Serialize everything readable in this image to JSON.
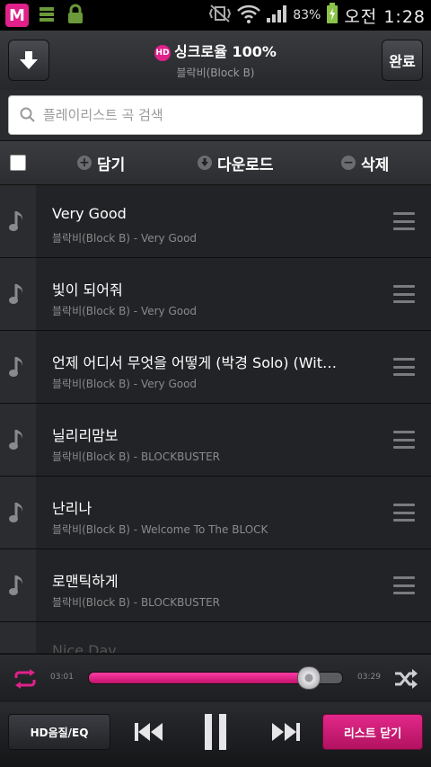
{
  "status_bar": {
    "battery": "83%",
    "clock": "오전 1:28",
    "app_icon_letter": "M"
  },
  "header": {
    "badge": "HD",
    "title": "싱크로율 100%",
    "subtitle": "블락비(Block B)",
    "done_label": "완료"
  },
  "search": {
    "placeholder": "플레이리스트 곡 검색"
  },
  "actions": {
    "add_label": "담기",
    "download_label": "다운로드",
    "delete_label": "삭제"
  },
  "songs": [
    {
      "title": "Very Good",
      "subtitle": "블락비(Block B) - Very Good"
    },
    {
      "title": "빛이 되어줘",
      "subtitle": "블락비(Block B) - Very Good"
    },
    {
      "title": "언제 어디서 무엇을 어떻게 (박경 Solo) (Wit…",
      "subtitle": "블락비(Block B) - Very Good"
    },
    {
      "title": "닐리리맘보",
      "subtitle": "블락비(Block B) - BLOCKBUSTER"
    },
    {
      "title": "난리나",
      "subtitle": "블락비(Block B) - Welcome To The BLOCK"
    },
    {
      "title": "로맨틱하게",
      "subtitle": "블락비(Block B) - BLOCKBUSTER"
    },
    {
      "title": "Nice Day",
      "subtitle": ""
    }
  ],
  "player": {
    "elapsed": "03:01",
    "duration": "03:29",
    "progress_fraction": 0.866,
    "hd_eq_label": "HD음질/EQ",
    "list_close_label": "리스트 닫기"
  },
  "colors": {
    "accent": "#e0218a",
    "background": "#1b1b1d"
  }
}
